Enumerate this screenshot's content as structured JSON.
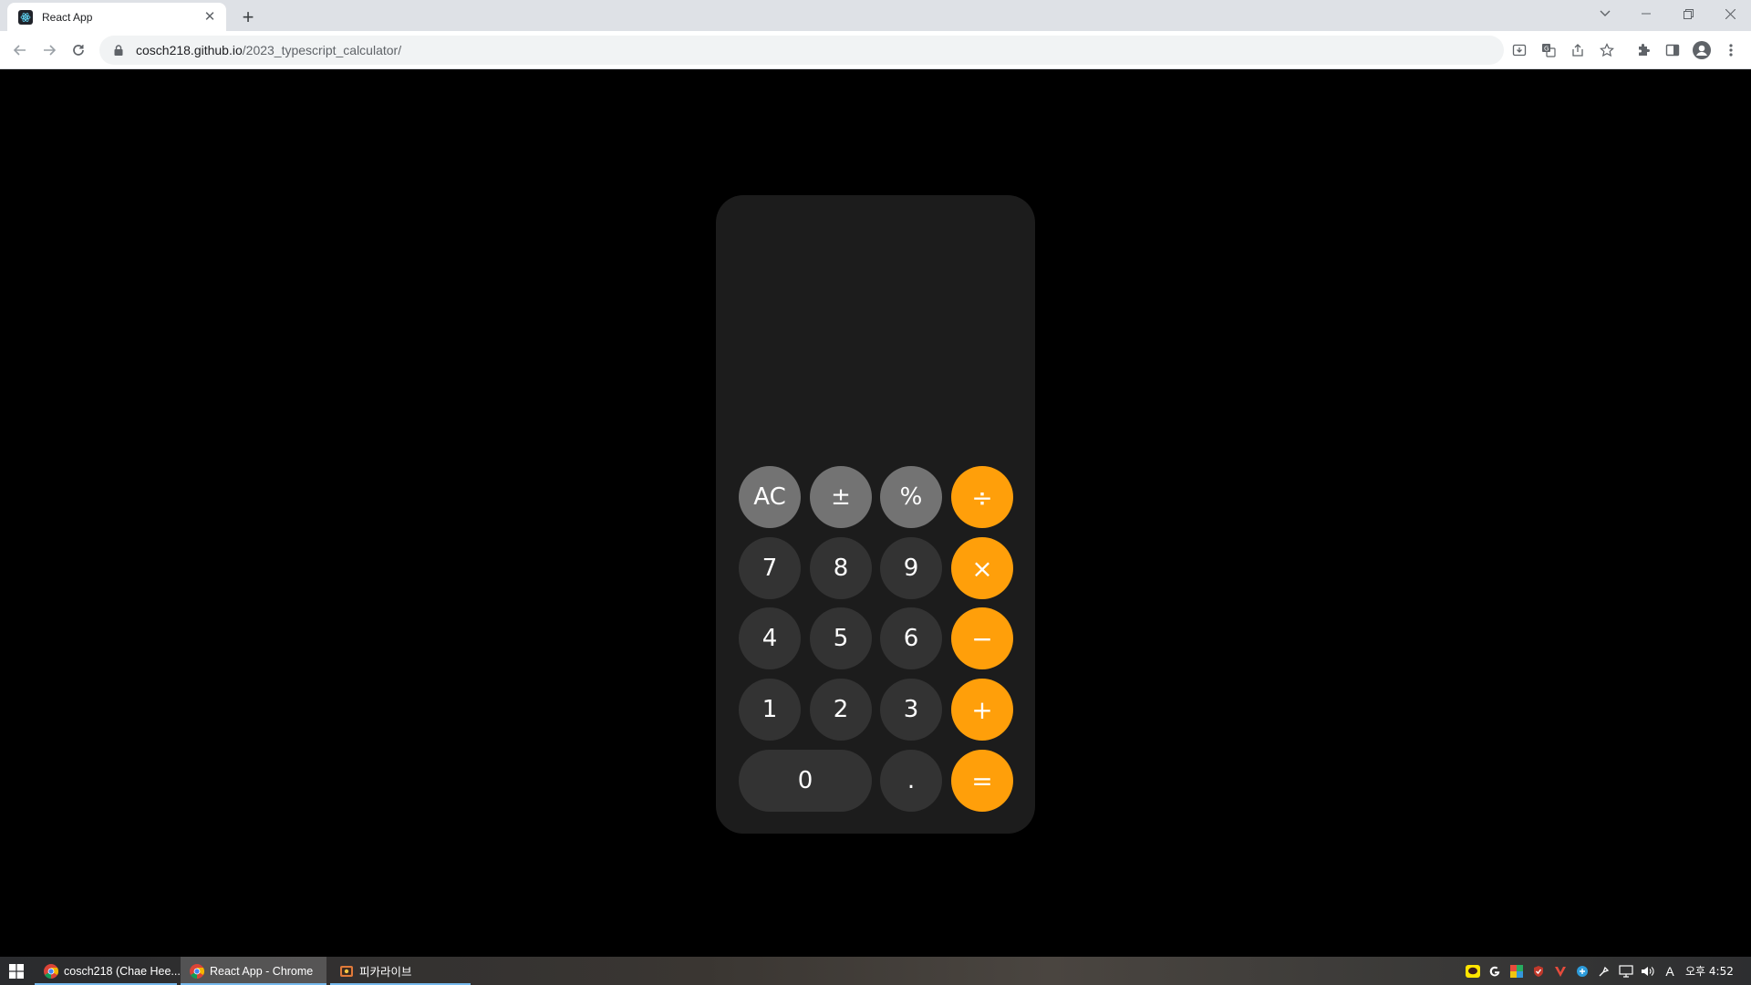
{
  "browser": {
    "tab_title": "React App",
    "url_host": "cosch218.github.io",
    "url_path": "/2023_typescript_calculator/"
  },
  "calculator": {
    "display_value": "",
    "keys": {
      "ac": "AC",
      "sign": "±",
      "percent": "%",
      "divide": "÷",
      "seven": "7",
      "eight": "8",
      "nine": "9",
      "multiply": "×",
      "four": "4",
      "five": "5",
      "six": "6",
      "minus": "−",
      "one": "1",
      "two": "2",
      "three": "3",
      "plus": "+",
      "zero": "0",
      "decimal": ".",
      "equals": "="
    },
    "colors": {
      "body": "#1c1c1c",
      "function_key": "#737373",
      "digit_key": "#333333",
      "operator_key": "#ff9f0a"
    }
  },
  "taskbar": {
    "items": [
      {
        "label": "cosch218 (Chae Hee..."
      },
      {
        "label": "React App - Chrome"
      },
      {
        "label": "피카라이브"
      }
    ],
    "clock": "오후 4:52",
    "ime": "A"
  }
}
